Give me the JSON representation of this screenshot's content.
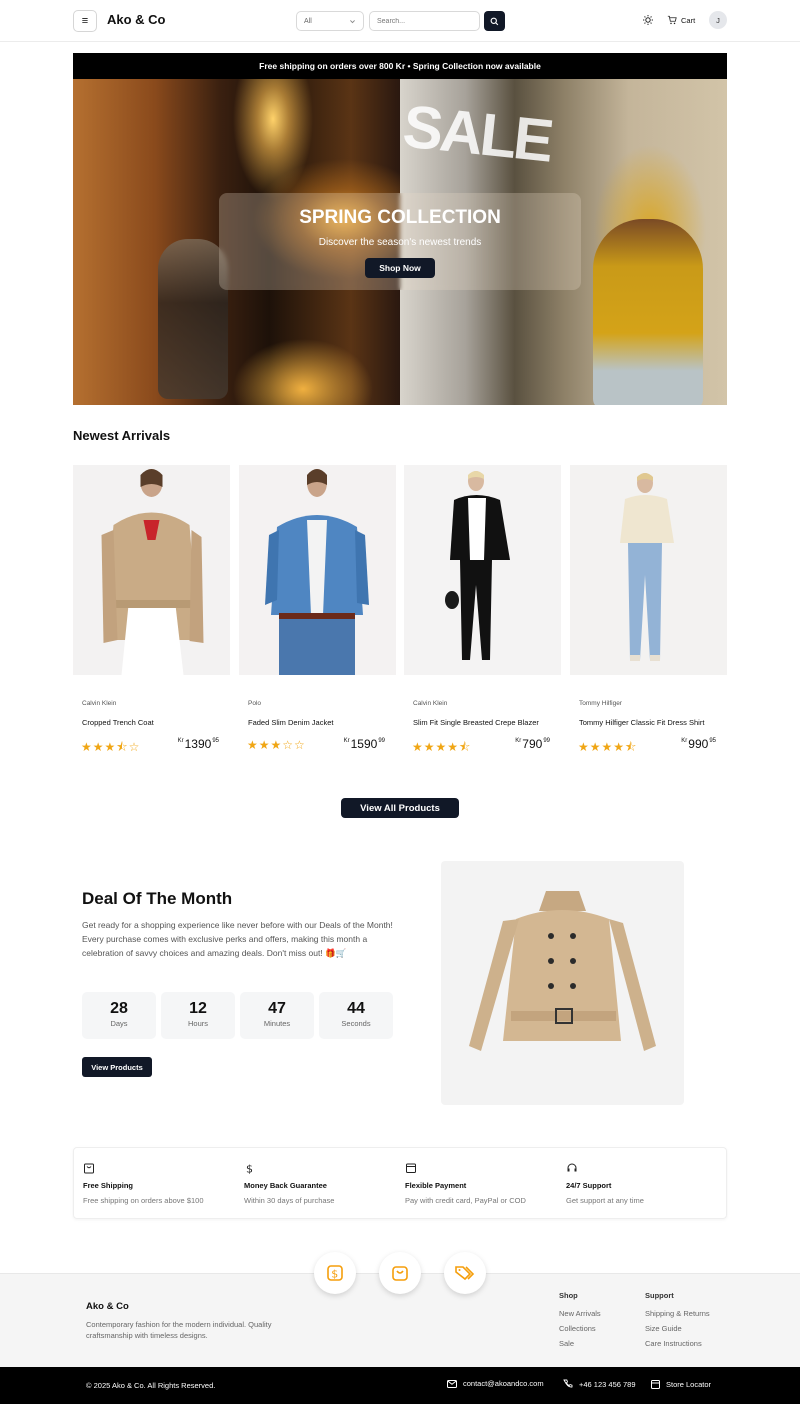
{
  "header": {
    "logo": "Ako & Co",
    "category_selected": "All",
    "search_placeholder": "Search...",
    "cart_label": "Cart",
    "avatar_initial": "J"
  },
  "promo": "Free shipping on orders over 800 Kr • Spring Collection now available",
  "hero": {
    "sale_sign": "SALE",
    "title": "SPRING COLLECTION",
    "subtitle": "Discover the season's newest trends",
    "cta": "Shop Now"
  },
  "arrivals": {
    "title": "Newest Arrivals",
    "products": [
      {
        "brand": "Calvin Klein",
        "name": "Cropped Trench Coat",
        "rating": 3.5,
        "stars": "★★★⯪☆",
        "currency": "Kr",
        "price": "1390",
        "decimals": "95"
      },
      {
        "brand": "Polo",
        "name": "Faded Slim Denim Jacket",
        "rating": 3,
        "stars": "★★★☆☆",
        "currency": "Kr",
        "price": "1590",
        "decimals": "99"
      },
      {
        "brand": "Calvin Klein",
        "name": "Slim Fit Single Breasted Crepe Blazer",
        "rating": 4.5,
        "stars": "★★★★⯪",
        "currency": "Kr",
        "price": "790",
        "decimals": "99"
      },
      {
        "brand": "Tommy Hilfiger",
        "name": "Tommy Hilfiger Classic Fit Dress Shirt",
        "rating": 4.5,
        "stars": "★★★★⯪",
        "currency": "Kr",
        "price": "990",
        "decimals": "95"
      }
    ],
    "view_all": "View All Products"
  },
  "deal": {
    "title": "Deal Of The Month",
    "text": "Get ready for a shopping experience like never before with our Deals of the Month! Every purchase comes with exclusive perks and offers, making this month a celebration of savvy choices and amazing deals. Don't miss out! 🎁🛒",
    "countdown": [
      {
        "value": "28",
        "label": "Days"
      },
      {
        "value": "12",
        "label": "Hours"
      },
      {
        "value": "47",
        "label": "Minutes"
      },
      {
        "value": "44",
        "label": "Seconds"
      }
    ],
    "cta": "View Products"
  },
  "features": [
    {
      "icon": "bag-icon",
      "title": "Free Shipping",
      "subtitle": "Free shipping on orders above $100"
    },
    {
      "icon": "dollar-icon",
      "title": "Money Back Guarantee",
      "subtitle": "Within 30 days of purchase"
    },
    {
      "icon": "wallet-icon",
      "title": "Flexible Payment",
      "subtitle": "Pay with credit card, PayPal or COD"
    },
    {
      "icon": "headset-icon",
      "title": "24/7 Support",
      "subtitle": "Get support at any time"
    }
  ],
  "footer": {
    "name": "Ako & Co",
    "description": "Contemporary fashion for the modern individual. Quality craftsmanship with timeless designs.",
    "shop_title": "Shop",
    "shop_links": [
      "New Arrivals",
      "Collections",
      "Sale"
    ],
    "support_title": "Support",
    "support_links": [
      "Shipping & Returns",
      "Size Guide",
      "Care Instructions"
    ],
    "copyright": "© 2025 Ako & Co. All Rights Reserved.",
    "email": "contact@akoandco.com",
    "phone": "+46 123 456 789",
    "store_locator": "Store Locator"
  },
  "colors": {
    "primary": "#111827",
    "accent": "#f59e0b",
    "star": "#f0a615"
  }
}
